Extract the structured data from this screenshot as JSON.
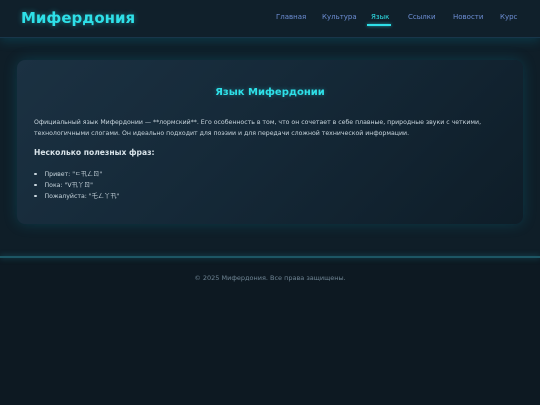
{
  "header": {
    "logo": "Мифердония",
    "nav": [
      {
        "label": "Главная"
      },
      {
        "label": "Культура"
      },
      {
        "label": "Язык"
      },
      {
        "label": "Ссылки"
      },
      {
        "label": "Новости"
      },
      {
        "label": "Курс"
      }
    ],
    "active_nav": "Язык"
  },
  "main": {
    "title": "Язык Мифердонии",
    "paragraph": "Официальный язык Мифердонии — **лормский**. Его особенность в том, что он сочетает в себе плавные, природные звуки с четкими, технологичными слогами. Он идеально подходит для поэзии и для передачи сложной технической информации.",
    "subheading": "Несколько полезных фраз:",
    "phrases": [
      {
        "label": "Привет:",
        "value": "\"ㄷ卂ㄥㄖ\""
      },
      {
        "label": "Пока:",
        "value": "\"V卂丫ㄖ\""
      },
      {
        "label": "Пожалуйста:",
        "value": "\"乇ㄥ丫卂\""
      }
    ]
  },
  "footer": {
    "text": "© 2025 Мифердония. Все права защищены."
  },
  "colors": {
    "accent": "#2ee0e8",
    "nav_link": "#6e8fd6",
    "background": "#0f1e28",
    "card": "#152938",
    "text": "#c9d6de",
    "footer_text": "#6f8594"
  }
}
